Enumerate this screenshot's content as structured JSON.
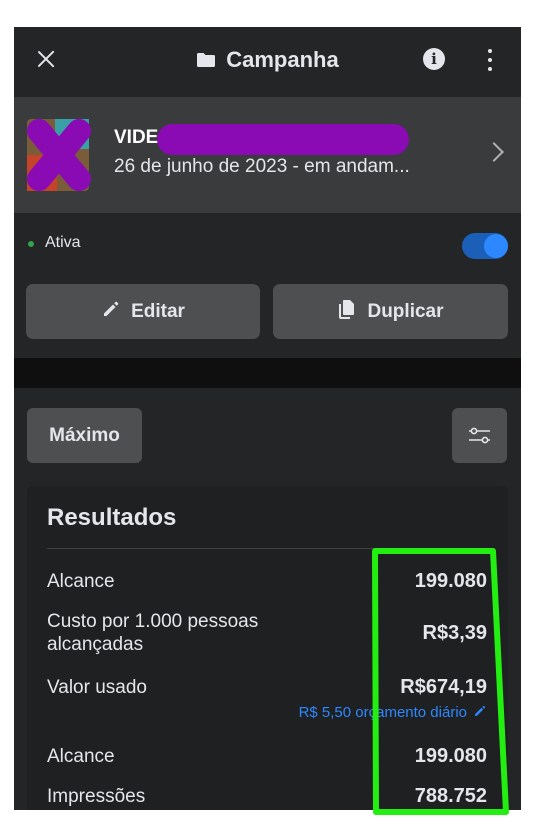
{
  "header": {
    "title": "Campanha"
  },
  "campaign": {
    "name_visible": "VIDE",
    "meta": "26 de junho de 2023 -  em andam..."
  },
  "status": {
    "label": "Ativa",
    "toggle_on": true
  },
  "actions": {
    "edit_label": "Editar",
    "duplicate_label": "Duplicar"
  },
  "view": {
    "mode_label": "Máximo"
  },
  "results": {
    "title": "Resultados",
    "rows": [
      {
        "label": "Alcance",
        "value": "199.080"
      },
      {
        "label": "Custo por 1.000 pessoas alcançadas",
        "value": "R$3,39"
      },
      {
        "label": "Valor usado",
        "value": "R$674,19"
      },
      {
        "label": "Alcance",
        "value": "199.080"
      },
      {
        "label": "Impressões",
        "value": "788.752"
      }
    ],
    "budget_note": "R$ 5,50 orçamento diário"
  },
  "colors": {
    "accent": "#2d88ff",
    "status_active": "#31a24c",
    "redaction": "#8a0ab4",
    "highlight": "#22ee11"
  },
  "icons": [
    "close-icon",
    "folder-icon",
    "info-icon",
    "more-icon",
    "chevron-right-icon",
    "pencil-icon",
    "duplicate-icon",
    "filter-icon"
  ]
}
